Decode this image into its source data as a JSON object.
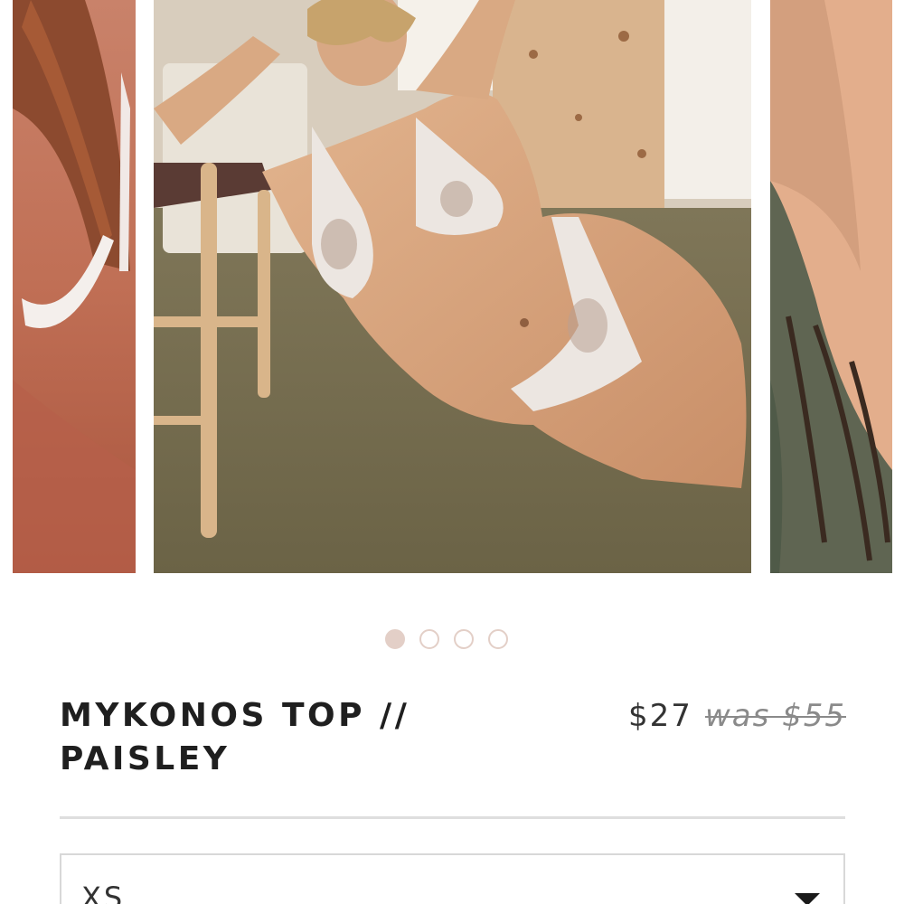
{
  "carousel": {
    "slides": [
      {
        "icon": "photo-model-side-view"
      },
      {
        "icon": "photo-model-reclining-in-bikini"
      },
      {
        "icon": "photo-model-wet-hair"
      }
    ],
    "active_index": 0,
    "dot_count": 4
  },
  "product": {
    "title_line1": "MYKONOS TOP //",
    "title_line2": "PAISLEY",
    "price": "$27",
    "was_price": "was $55"
  },
  "size_select": {
    "value": "XS",
    "icon": "caret-down-icon"
  },
  "colors": {
    "dot_accent": "#e3cfc7",
    "title_text": "#1f1f1f",
    "price_text": "#333333",
    "strike_text": "#8a8a8a",
    "border": "#d8d8d8"
  }
}
